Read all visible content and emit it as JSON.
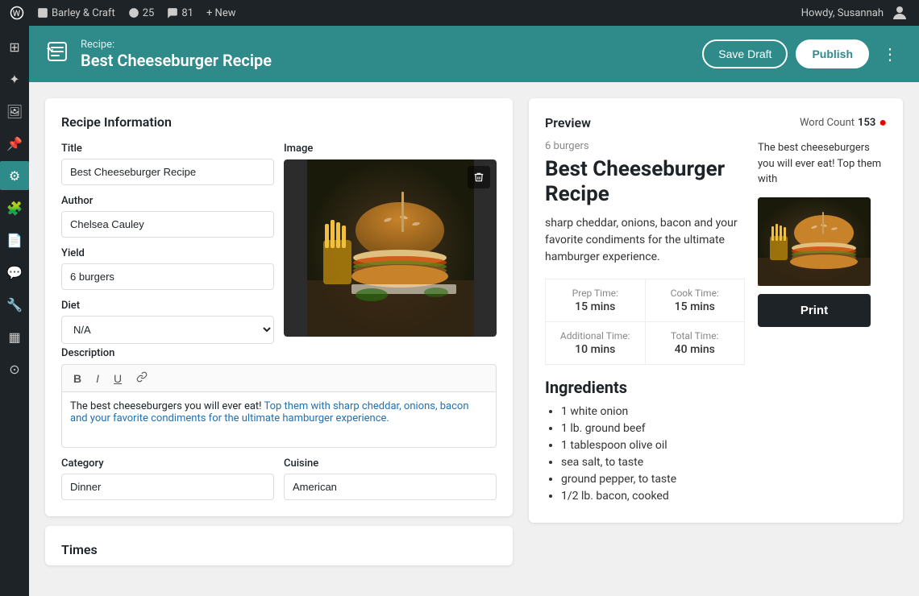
{
  "adminBar": {
    "siteName": "Barley & Craft",
    "updates": "25",
    "comments": "81",
    "newLabel": "+ New",
    "howdy": "Howdy, Susannah"
  },
  "postHeader": {
    "recipeLabel": "Recipe:",
    "recipeTitle": "Best Cheeseburger Recipe",
    "saveDraftLabel": "Save Draft",
    "publishLabel": "Publish"
  },
  "recipeForm": {
    "sectionTitle": "Recipe Information",
    "titleLabel": "Title",
    "titleValue": "Best Cheeseburger Recipe",
    "authorLabel": "Author",
    "authorValue": "Chelsea Cauley",
    "yieldLabel": "Yield",
    "yieldValue": "6 burgers",
    "dietLabel": "Diet",
    "dietValue": "N/A",
    "imageLabel": "Image",
    "descriptionLabel": "Description",
    "descriptionText": "The best cheeseburgers you will ever eat! Top them with sharp cheddar, onions, bacon and your favorite condiments for the ultimate hamburger experience.",
    "descriptionHighlighted": "Top them with sharp cheddar, onions, bacon and your favorite condiments for the ultimate hamburger experience.",
    "categoryLabel": "Category",
    "categoryValue": "Dinner",
    "cuisineLabel": "Cuisine",
    "cuisineValue": "American"
  },
  "preview": {
    "sectionTitle": "Preview",
    "wordCountLabel": "Word Count",
    "wordCount": "153",
    "yield": "6 burgers",
    "recipeTitle": "Best Cheeseburger Recipe",
    "description": "sharp cheddar, onions, bacon and your favorite condiments for the ultimate hamburger experience.",
    "sidebarText": "The best cheeseburgers you will ever eat! Top them with",
    "times": {
      "prepLabel": "Prep Time:",
      "prepValue": "15 mins",
      "cookLabel": "Cook Time:",
      "cookValue": "15 mins",
      "additionalLabel": "Additional Time:",
      "additionalValue": "10 mins",
      "totalLabel": "Total Time:",
      "totalValue": "40 mins"
    },
    "ingredientsTitle": "Ingredients",
    "ingredients": [
      "1 white onion",
      "1 lb. ground beef",
      "1 tablespoon olive oil",
      "sea salt, to taste",
      "ground pepper, to taste",
      "1/2 lb. bacon, cooked"
    ],
    "printLabel": "Print"
  },
  "bottomSection": {
    "title": "Times"
  },
  "icons": {
    "bold": "B",
    "italic": "I",
    "underline": "U",
    "link": "🔗",
    "delete": "🗑",
    "more": "⋮"
  }
}
